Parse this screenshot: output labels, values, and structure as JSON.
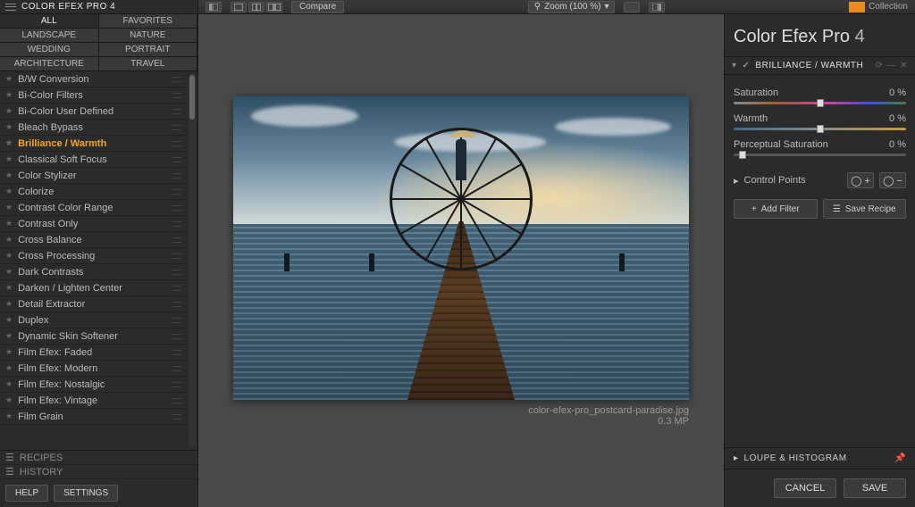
{
  "header": {
    "app_title": "COLOR EFEX PRO 4",
    "compare_label": "Compare",
    "zoom_label": "Zoom (100 %)",
    "brand_text": "Collection"
  },
  "categories": {
    "items": [
      "ALL",
      "FAVORITES",
      "LANDSCAPE",
      "NATURE",
      "WEDDING",
      "PORTRAIT",
      "ARCHITECTURE",
      "TRAVEL"
    ],
    "active_index": 0
  },
  "filters": [
    "B/W Conversion",
    "Bi-Color Filters",
    "Bi-Color User Defined",
    "Bleach Bypass",
    "Brilliance / Warmth",
    "Classical Soft Focus",
    "Color Stylizer",
    "Colorize",
    "Contrast Color Range",
    "Contrast Only",
    "Cross Balance",
    "Cross Processing",
    "Dark Contrasts",
    "Darken / Lighten Center",
    "Detail Extractor",
    "Duplex",
    "Dynamic Skin Softener",
    "Film Efex: Faded",
    "Film Efex: Modern",
    "Film Efex: Nostalgic",
    "Film Efex: Vintage",
    "Film Grain"
  ],
  "selected_filter_index": 4,
  "left_footer": {
    "recipes": "RECIPES",
    "history": "HISTORY",
    "help": "HELP",
    "settings": "SETTINGS"
  },
  "image": {
    "filename": "color-efex-pro_postcard-paradise.jpg",
    "size": "0.3 MP"
  },
  "right": {
    "panel_title": "Color Efex Pro",
    "panel_title_suffix": "4",
    "section_label": "BRILLIANCE / WARMTH",
    "sliders": [
      {
        "label": "Saturation",
        "value": "0 %",
        "class": "rainbow",
        "pos": 50
      },
      {
        "label": "Warmth",
        "value": "0 %",
        "class": "bluegold",
        "pos": 50
      },
      {
        "label": "Perceptual Saturation",
        "value": "0 %",
        "class": "",
        "pos": 5
      }
    ],
    "control_points_label": "Control Points",
    "add_filter": "Add Filter",
    "save_recipe": "Save Recipe",
    "loupe": "LOUPE & HISTOGRAM",
    "cancel": "CANCEL",
    "save": "SAVE"
  }
}
